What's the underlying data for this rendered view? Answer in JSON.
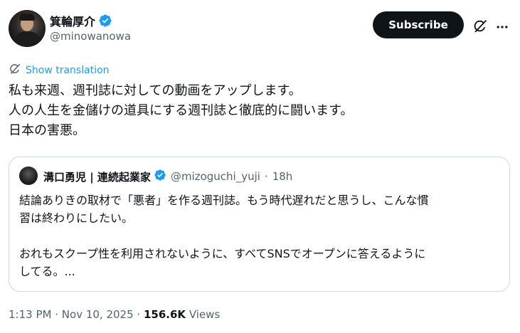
{
  "author": {
    "name": "箕輪厚介",
    "handle": "@minowanowa"
  },
  "header": {
    "subscribe_label": "Subscribe"
  },
  "translate_label": "Show translation",
  "tweet": {
    "lines": [
      "私も来週、週刊誌に対しての動画をアップします。",
      "人の人生を金儲けの道具にする週刊誌と徹底的に闘います。",
      "日本の害悪。"
    ]
  },
  "quote": {
    "name": "溝口勇児 | 連続起業家",
    "handle": "@mizoguchi_yuji",
    "separator": "·",
    "time": "18h",
    "lines": [
      "結論ありきの取材で「悪者」を作る週刊誌。もう時代遅れだと思うし、こんな慣",
      "習は終わりにしたい。",
      "",
      "おれもスクープ性を利用されないように、すべてSNSでオープンに答えるように",
      "してる。..."
    ]
  },
  "meta": {
    "time": "1:13 PM",
    "sep1": "·",
    "date": "Nov 10, 2025",
    "sep2": "·",
    "views_count": "156.6K",
    "views_label": "Views"
  },
  "colors": {
    "accent": "#1d9bf0",
    "text": "#0f1419",
    "muted": "#536471",
    "border": "#cfd9de"
  },
  "icons": [
    "verified-badge-icon",
    "grok-icon",
    "more-icon",
    "translate-icon"
  ]
}
